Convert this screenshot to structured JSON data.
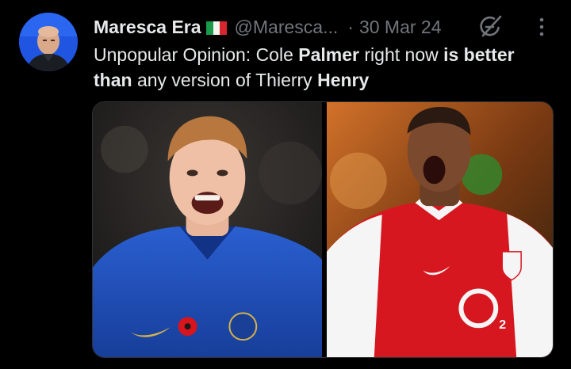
{
  "tweet": {
    "display_name": "Maresca Era",
    "handle": "@Maresca...",
    "separator": "·",
    "date": "30 Mar 24",
    "text_parts": [
      {
        "text": "Unpopular Opinion: Cole ",
        "bold": false
      },
      {
        "text": "Palmer",
        "bold": true
      },
      {
        "text": " right now ",
        "bold": false
      },
      {
        "text": "is better than",
        "bold": true
      },
      {
        "text": " any version of Thierry ",
        "bold": false
      },
      {
        "text": "Henry",
        "bold": true
      }
    ]
  },
  "icons": {
    "flag": "italy-flag-icon",
    "grok": "grok-icon",
    "more": "more-options-icon"
  },
  "media": {
    "left_photo": "cole-palmer-photo",
    "right_photo": "thierry-henry-photo"
  },
  "colors": {
    "background": "#000000",
    "text_primary": "#e7e9ea",
    "text_secondary": "#71767b",
    "chelsea_blue": "#1f4fb8",
    "arsenal_red": "#d7171f"
  }
}
